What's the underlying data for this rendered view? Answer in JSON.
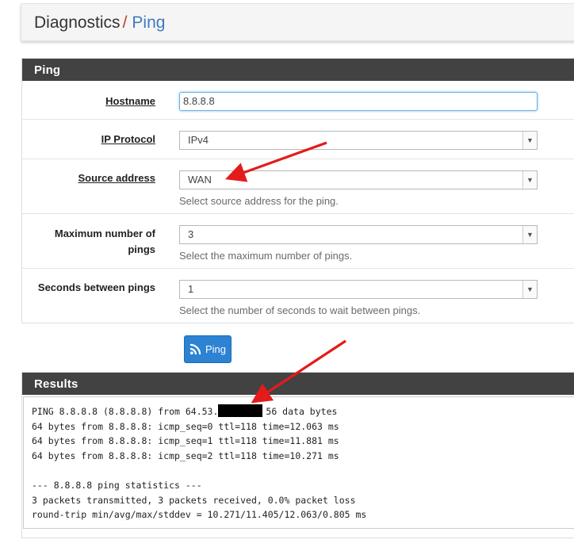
{
  "breadcrumb": {
    "section": "Diagnostics",
    "separator": "/",
    "current": "Ping"
  },
  "ping_panel": {
    "title": "Ping",
    "hostname": {
      "label": "Hostname",
      "value": "8.8.8.8"
    },
    "ip_protocol": {
      "label": "IP Protocol",
      "value": "IPv4"
    },
    "source_address": {
      "label": "Source address",
      "value": "WAN",
      "help": "Select source address for the ping."
    },
    "max_pings": {
      "label_line1": "Maximum number of",
      "label_line2": "pings",
      "value": "3",
      "help": "Select the maximum number of pings."
    },
    "seconds_between": {
      "label": "Seconds between pings",
      "value": "1",
      "help": "Select the number of seconds to wait between pings."
    }
  },
  "ping_button": {
    "label": "Ping",
    "icon": "rss-icon"
  },
  "results_panel": {
    "title": "Results",
    "line1_prefix": "PING 8.8.8.8 (8.8.8.8) from 64.53.",
    "line1_suffix": "56 data bytes",
    "lines": [
      "64 bytes from 8.8.8.8: icmp_seq=0 ttl=118 time=12.063 ms",
      "64 bytes from 8.8.8.8: icmp_seq=1 ttl=118 time=11.881 ms",
      "64 bytes from 8.8.8.8: icmp_seq=2 ttl=118 time=10.271 ms",
      "",
      "--- 8.8.8.8 ping statistics ---",
      "3 packets transmitted, 3 packets received, 0.0% packet loss",
      "round-trip min/avg/max/stddev = 10.271/11.405/12.063/0.805 ms"
    ]
  },
  "annotation_color": "#e41b1b",
  "button_color": "#2c82d3"
}
